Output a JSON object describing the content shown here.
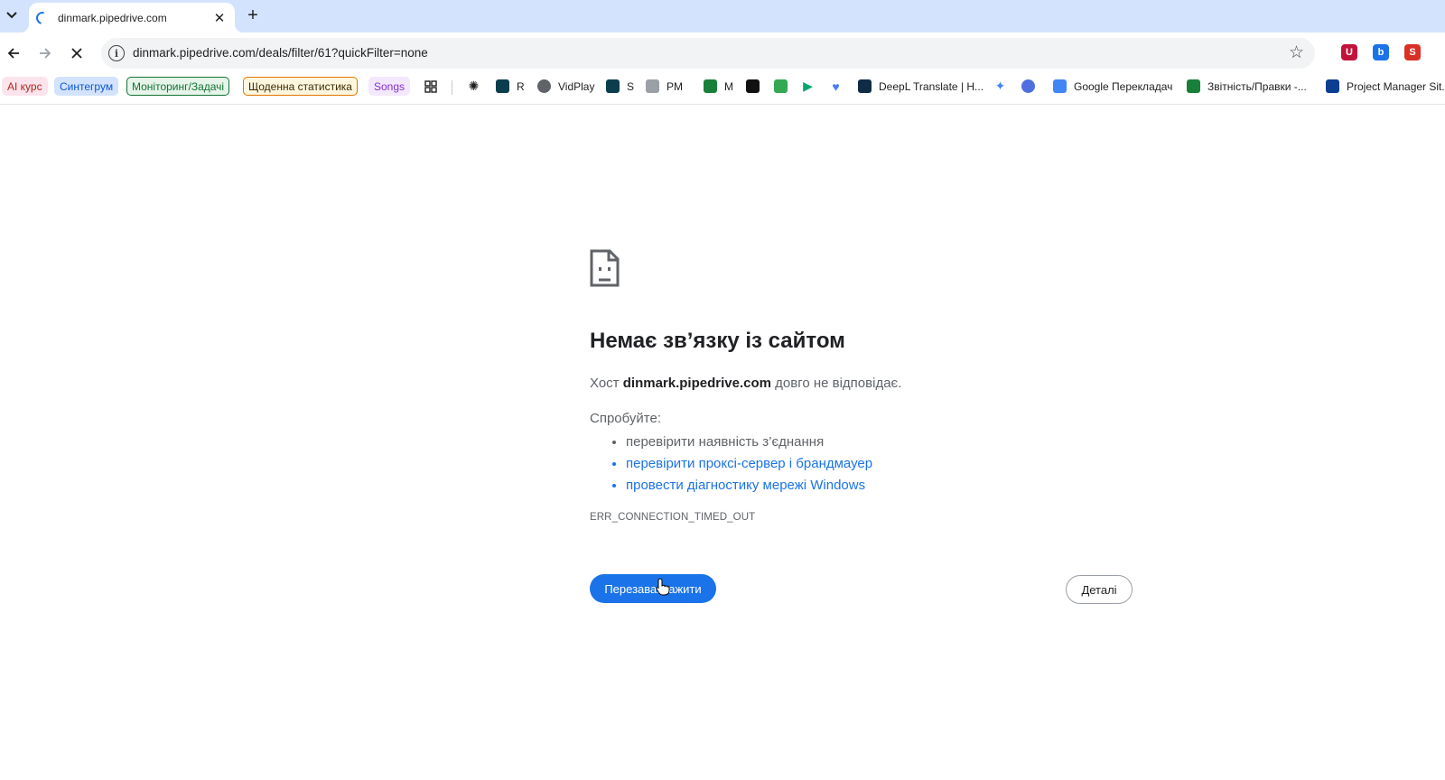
{
  "browser": {
    "tab": {
      "title": "dinmark.pipedrive.com",
      "close": "✕"
    },
    "new_tab": "+",
    "url": "dinmark.pipedrive.com/deals/filter/61?quickFilter=none",
    "icons": [
      "tab-list-icon",
      "loading-spinner-icon",
      "back-icon",
      "forward-icon",
      "stop-icon",
      "site-info-icon",
      "bookmark-star-icon"
    ],
    "extensions": [
      {
        "name": "ublock-icon",
        "color": "#c0143c",
        "glyph": "U"
      },
      {
        "name": "extension-b-icon",
        "color": "#1a73e8",
        "glyph": "b"
      },
      {
        "name": "extension-s-icon",
        "color": "#d93025",
        "glyph": "S"
      }
    ]
  },
  "bookmarks": {
    "pills": [
      {
        "label": "AI курс",
        "bg": "#fce4ec",
        "fg": "#b3261e",
        "border": "none"
      },
      {
        "label": "Синтегрум",
        "bg": "#d3e3fd",
        "fg": "#0b57d0",
        "border": "none"
      },
      {
        "label": "Моніторинг/Задачі",
        "bg": "#e6f4ea",
        "fg": "#137333",
        "border": "#137333"
      },
      {
        "label": "Щоденна статистика",
        "bg": "#fef7e0",
        "fg": "#3c2a00",
        "border": "#e37400"
      },
      {
        "label": "Songs",
        "bg": "#f3e8fd",
        "fg": "#8430ce",
        "border": "none"
      }
    ],
    "items": [
      {
        "label": "R",
        "color": "#0b3d4f"
      },
      {
        "label": "VidPlay",
        "color": "#5f6368"
      },
      {
        "label": "S",
        "color": "#0b3d4f"
      },
      {
        "label": "PM",
        "color": "#9aa0a6"
      },
      {
        "label": "M",
        "color": "#188038"
      },
      {
        "label": "DeepL Translate | H...",
        "color": "#0f2b46"
      },
      {
        "label": "Google Перекладач",
        "color": "#4285f4"
      },
      {
        "label": "Звітність/Правки -...",
        "color": "#188038"
      },
      {
        "label": "Project Manager Sit...",
        "color": "#0b3d91"
      }
    ]
  },
  "error_page": {
    "title": "Немає зв’язку із сайтом",
    "desc_prefix": "Хост",
    "host": "dinmark.pipedrive.com",
    "desc_suffix": "довго не відповідає.",
    "try_label": "Спробуйте:",
    "suggestions": [
      "перевірити наявність з’єднання",
      "перевірити проксі-сервер і брандмауер",
      "провести діагностику мережі Windows"
    ],
    "error_code": "ERR_CONNECTION_TIMED_OUT",
    "reload_button": "Перезавантажити",
    "details_button": "Деталі"
  }
}
